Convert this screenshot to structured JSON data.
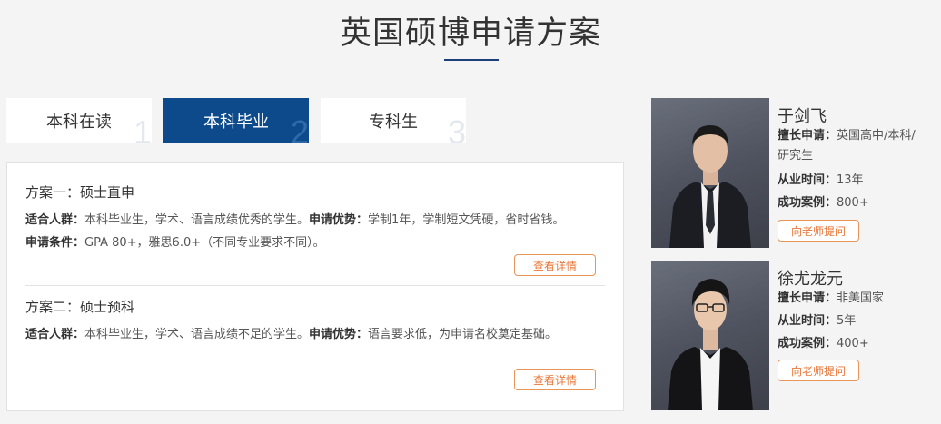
{
  "page_title": "英国硕博申请方案",
  "tabs": [
    {
      "label": "本科在读",
      "num": "1",
      "active": false
    },
    {
      "label": "本科毕业",
      "num": "2",
      "active": true
    },
    {
      "label": "专科生",
      "num": "3",
      "active": false
    }
  ],
  "plans": [
    {
      "title": "方案一：硕士直申",
      "suit_label": "适合人群：",
      "suit_text": "本科毕业生，学术、语言成绩优秀的学生。",
      "adv_label": "申请优势：",
      "adv_text": "学制1年，学制短文凭硬，省时省钱。",
      "cond_label": "申请条件：",
      "cond_text": "GPA 80+，雅思6.0+（不同专业要求不同）。",
      "button": "查看详情"
    },
    {
      "title": "方案二：硕士预科",
      "suit_label": "适合人群：",
      "suit_text": "本科毕业生，学术、语言成绩不足的学生。",
      "adv_label": "申请优势：",
      "adv_text": "语言要求低，为申请名校奠定基础。",
      "button": "查看详情"
    }
  ],
  "teachers": [
    {
      "name": "于剑飞",
      "specialty_label": "擅长申请：",
      "specialty_line1": "英国高中/本科/",
      "specialty_line2": "研究生",
      "years_label": "从业时间：",
      "years": "13年",
      "cases_label": "成功案例：",
      "cases": "800+",
      "button": "向老师提问"
    },
    {
      "name": "徐尤龙元",
      "specialty_label": "擅长申请：",
      "specialty_line1": "非美国家",
      "years_label": "从业时间：",
      "years": "5年",
      "cases_label": "成功案例：",
      "cases": "400+",
      "button": "向老师提问"
    }
  ],
  "colors": {
    "accent": "#0d4a8c",
    "button_border": "#e8955a",
    "button_text": "#e8783a",
    "background": "#f4f4f4"
  }
}
